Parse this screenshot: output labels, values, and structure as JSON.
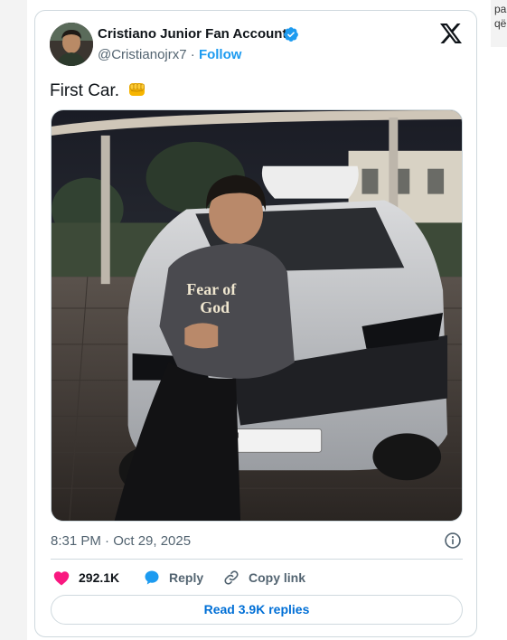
{
  "side_panel": {
    "text_line1": "pa",
    "text_line2": "që"
  },
  "tweet": {
    "author_name": "Cristiano Junior Fan Account",
    "handle": "@Cristianojrx7",
    "separator": "·",
    "follow_label": "Follow",
    "text": "First Car.",
    "emoji_icon": "oncoming-fist-icon",
    "timestamp": "8:31 PM · Oct 29, 2025",
    "actions": {
      "likes": "292.1K",
      "reply_label": "Reply",
      "copy_link_label": "Copy link"
    },
    "read_replies_label": "Read 3.9K replies"
  },
  "icons": {
    "verified": "verified-badge-icon",
    "logo": "x-logo-icon",
    "info": "info-icon",
    "heart": "heart-icon",
    "reply": "reply-bubble-icon",
    "link": "link-icon"
  },
  "colors": {
    "accent": "#1d9bf0",
    "heart": "#f91880",
    "link_blue": "#006fd6",
    "muted": "#536471",
    "text": "#0f1419",
    "border": "#cfd9de"
  }
}
